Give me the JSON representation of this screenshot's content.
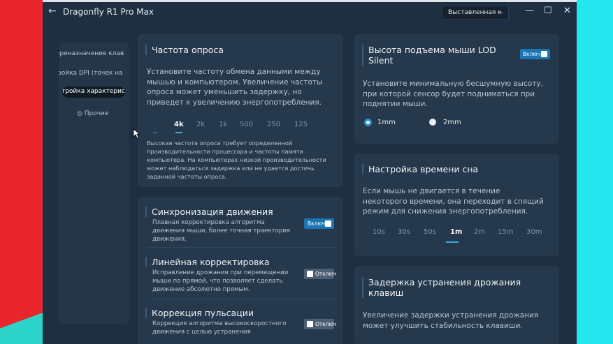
{
  "window": {
    "title": "Dragonfly R1 Pro Max",
    "preset_select": "Выставленная к",
    "controls": [
      "—",
      "☐",
      "✕"
    ]
  },
  "sidebar": {
    "items": [
      {
        "label": "ереназначение клав"
      },
      {
        "label": "ройка DPI (точек на"
      },
      {
        "label": "стройка характерис"
      },
      {
        "label": "Прочие"
      }
    ]
  },
  "polling": {
    "title": "Частота опроса",
    "description": "Установите частоту обмена данными между мышью и компьютером. Увеличение частоты опроса может уменьшить задержку, но приведет к увеличению энергопотребления.",
    "options": [
      "4k",
      "2k",
      "1k",
      "500",
      "250",
      "125"
    ],
    "selected": "4k",
    "note": "Высокая частота опроса требует определенной производительности процессора и частоты памяти компьютера. На компьютерах низкой производительности может наблюдаться задержка или не удается достичь заданной частоты опроса."
  },
  "motion": {
    "sync": {
      "title": "Синхронизация движения",
      "description": "Плавная корректировка алгоритма движения мыши, более точная траектория движения.",
      "toggle": "Включ"
    },
    "linear": {
      "title": "Линейная корректировка",
      "description": "Исправление дрожания при перемещении мыши по прямой, что позволяет сделать движение абсолютно прямым.",
      "toggle": "Отключ"
    },
    "ripple": {
      "title": "Коррекция пульсации",
      "description": "Коррекция алгоритма высокоскоростного движения с целью устранения",
      "toggle": "Отключ"
    }
  },
  "lod": {
    "title": "Высота подъема мыши LOD Silent",
    "toggle": "Включ",
    "description": "Установите минимальную бесшумную высоту, при которой сенсор будет подниматься при поднятии мыши.",
    "options": [
      "1mm",
      "2mm"
    ],
    "selected": "1mm"
  },
  "sleep": {
    "title": "Настройка времени сна",
    "description": "Если мышь не двигается в течение некоторого времени, она переходит в спящий режим для снижения энергопотребления.",
    "options": [
      "10s",
      "30s",
      "50s",
      "1m",
      "2m",
      "15m",
      "30m"
    ],
    "selected": "1m"
  },
  "debounce": {
    "title": "Задержка устранения дрожания клавиш",
    "description": "Увеличение задержки устранения дрожания может улучшить стабильность клавиши."
  },
  "colors": {
    "accent": "#3fa9e0",
    "toggle_on": "#1b74b4",
    "card": "#26384b",
    "window": "#1f2f42"
  }
}
